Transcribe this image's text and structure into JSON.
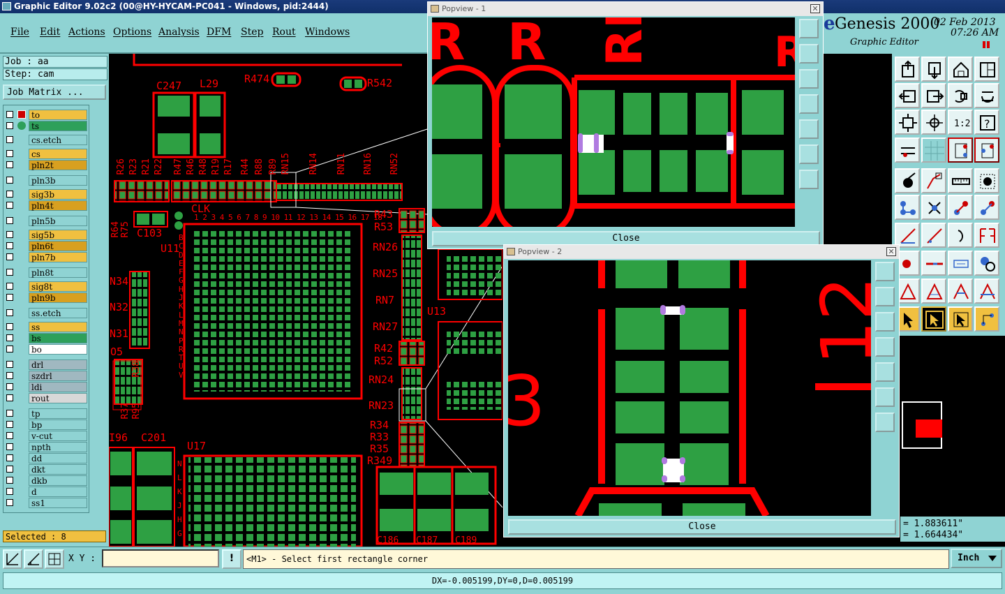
{
  "window": {
    "title": "Graphic Editor 9.02c2 (00@HY-HYCAM-PC041 - Windows, pid:2444)"
  },
  "menu": [
    "File",
    "Edit",
    "Actions",
    "Options",
    "Analysis",
    "DFM",
    "Step",
    "Rout",
    "Windows"
  ],
  "job": {
    "job_label": "Job : aa",
    "step_label": "Step: cam",
    "matrix_button": "Job Matrix ..."
  },
  "layers": [
    {
      "name": "to",
      "color": "#f0c040"
    },
    {
      "name": "ts",
      "color": "#2ea05a"
    },
    {
      "name": "cs.etch",
      "color": "#8fd3d3"
    },
    {
      "name": "cs",
      "color": "#f0c040"
    },
    {
      "name": "pln2t",
      "color": "#d8a020"
    },
    {
      "name": "pln3b",
      "color": "#8fd3d3"
    },
    {
      "name": "sig3b",
      "color": "#f0c040"
    },
    {
      "name": "pln4t",
      "color": "#d8a020"
    },
    {
      "name": "pln5b",
      "color": "#8fd3d3"
    },
    {
      "name": "sig5b",
      "color": "#f0c040"
    },
    {
      "name": "pln6t",
      "color": "#d8a020"
    },
    {
      "name": "pln7b",
      "color": "#f0c040"
    },
    {
      "name": "pln8t",
      "color": "#8fd3d3"
    },
    {
      "name": "sig8t",
      "color": "#f0c040"
    },
    {
      "name": "pln9b",
      "color": "#d8a020"
    },
    {
      "name": "ss.etch",
      "color": "#8fd3d3"
    },
    {
      "name": "ss",
      "color": "#f0c040"
    },
    {
      "name": "bs",
      "color": "#2ea05a"
    },
    {
      "name": "bo",
      "color": "#ffffff"
    },
    {
      "name": "drl",
      "color": "#a0b8c0"
    },
    {
      "name": "szdrl",
      "color": "#a0b8c0"
    },
    {
      "name": "ldi",
      "color": "#a0b8c0"
    },
    {
      "name": "rout",
      "color": "#d8d8d8"
    },
    {
      "name": "tp",
      "color": "#8fd3d3"
    },
    {
      "name": "bp",
      "color": "#8fd3d3"
    },
    {
      "name": "v-cut",
      "color": "#8fd3d3"
    },
    {
      "name": "npth",
      "color": "#8fd3d3"
    },
    {
      "name": "dd",
      "color": "#8fd3d3"
    },
    {
      "name": "dkt",
      "color": "#8fd3d3"
    },
    {
      "name": "dkb",
      "color": "#8fd3d3"
    },
    {
      "name": "d",
      "color": "#8fd3d3"
    },
    {
      "name": "ss1",
      "color": "#8fd3d3"
    }
  ],
  "selected": "Selected : 8",
  "canvas_labels": {
    "c247": "C247",
    "l29": "L29",
    "r474": "R474",
    "r542": "R542",
    "r26": "R26",
    "r23": "R23",
    "r21": "R21",
    "r22": "R22",
    "r47": "R47",
    "r46": "R46",
    "r48": "R48",
    "r19": "R19",
    "r17": "R17",
    "r44": "R44",
    "r88": "R88",
    "r89": "R89",
    "rn15": "RN15",
    "rn14": "RN14",
    "rn11": "RN11",
    "rn16": "RN16",
    "rn52": "RN52",
    "clk": "CLK",
    "c103": "C103",
    "r64": "R64",
    "r75": "R75",
    "u11": "U11",
    "cols": "1 2 3 4 5 6 7 8 9 10 11 12 13 14 15 16 17 18",
    "r43": "R43",
    "r53": "R53",
    "rn26": "RN26",
    "rn25": "RN25",
    "rn7": "RN7",
    "rn27": "RN27",
    "r42": "R42",
    "r52": "R52",
    "rn24": "RN24",
    "rn23": "RN23",
    "r34": "R34",
    "r33": "R33",
    "r35": "R35",
    "r349": "R349",
    "n34": "N34",
    "n32": "N32",
    "n31": "N31",
    "o5": "O5",
    "r38": "R38",
    "r37": "R37",
    "r95": "R95",
    "c196": "I96",
    "c201": "C201",
    "u17": "U17",
    "u13": "U13",
    "c186": "C186",
    "c187": "C187",
    "c189": "C189",
    "rows_u11": "B C D E F G H J K L M N P R T U V",
    "rows_u17": "N L K J H G"
  },
  "popview1": {
    "title": "Popview - 1",
    "close_x": "✕",
    "close_label": "Close"
  },
  "popview2": {
    "title": "Popview - 2",
    "close_x": "✕",
    "close_label": "Close"
  },
  "genesis": {
    "logo_letter": "e",
    "brand": "Genesis 2000",
    "subtitle": "Graphic Editor",
    "date": "02 Feb 2013",
    "time": "07:26 AM"
  },
  "coords": {
    "x": "= 1.883611\"",
    "y": "= 1.664434\""
  },
  "bottombar": {
    "xy_label": "X Y :",
    "xy_value": "",
    "prompt": "<M1> - Select first rectangle corner",
    "unit": "Inch",
    "excl": "!"
  },
  "status": "DX=-0.005199,DY=0,D=0.005199",
  "colors": {
    "panel": "#8fd3d3",
    "trace": "#ff0000",
    "pad": "#2ea043"
  }
}
